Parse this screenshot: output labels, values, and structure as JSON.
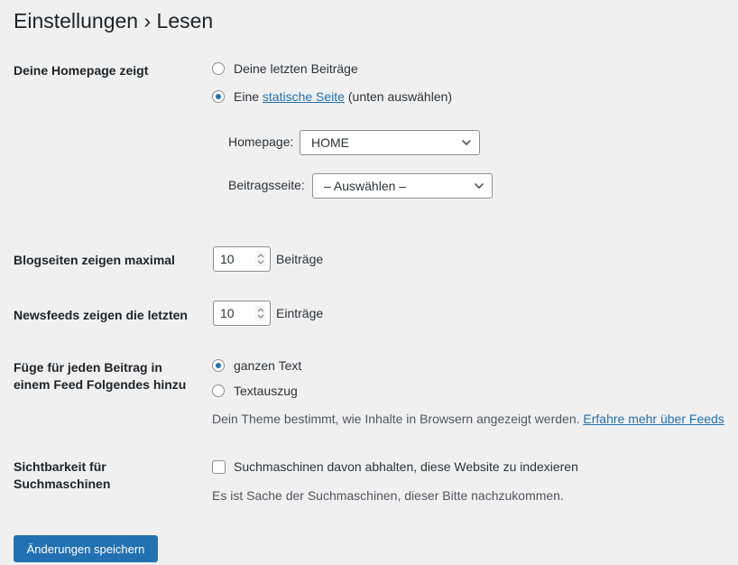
{
  "page": {
    "title": "Einstellungen › Lesen"
  },
  "homepage_section": {
    "label": "Deine Homepage zeigt",
    "option_latest": "Deine letzten Beiträge",
    "option_static_prefix": "Eine",
    "option_static_link": "statische Seite",
    "option_static_suffix": "(unten auswählen)",
    "selected": "static",
    "homepage_label": "Homepage:",
    "homepage_value": "HOME",
    "posts_page_label": "Beitragsseite:",
    "posts_page_value": "– Auswählen –"
  },
  "blog_pages": {
    "label": "Blogseiten zeigen maximal",
    "value": "10",
    "unit": "Beiträge"
  },
  "newsfeeds": {
    "label": "Newsfeeds zeigen die letzten",
    "value": "10",
    "unit": "Einträge"
  },
  "feed_content": {
    "label": "Füge für jeden Beitrag in einem Feed Folgendes hinzu",
    "option_full": "ganzen Text",
    "option_excerpt": "Textauszug",
    "selected": "full",
    "description": "Dein Theme bestimmt, wie Inhalte in Browsern angezeigt werden.",
    "learn_more_link": "Erfahre mehr über Feeds"
  },
  "search_visibility": {
    "label": "Sichtbarkeit für Suchmaschinen",
    "checkbox_label": "Suchmaschinen davon abhalten, diese Website zu indexieren",
    "checked": false,
    "description": "Es ist Sache der Suchmaschinen, dieser Bitte nachzukommen."
  },
  "actions": {
    "save_label": "Änderungen speichern"
  },
  "colors": {
    "background": "#f0f0f1",
    "accent": "#2271b1",
    "text": "#1d2327",
    "muted": "#50575e"
  }
}
